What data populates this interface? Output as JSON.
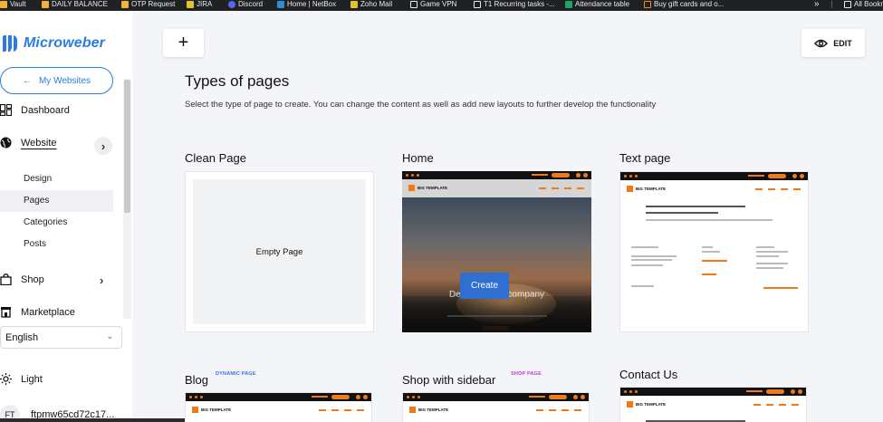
{
  "bookmarks": [
    {
      "label": "Vault",
      "color": "#f2b233"
    },
    {
      "label": "DAILY BALANCE",
      "color": "#f2b233"
    },
    {
      "label": "OTP Request",
      "color": "#f2b233"
    },
    {
      "label": "JIRA",
      "color": "#e0c229"
    },
    {
      "label": "Discord",
      "color": "#5865f2"
    },
    {
      "label": "Home | NetBox",
      "color": "#2f8bd6"
    },
    {
      "label": "Zoho Mail",
      "color": "#e8eaed"
    },
    {
      "label": "Game VPN",
      "color": "#e8eaed"
    },
    {
      "label": "T1 Recurring tasks -...",
      "color": "#e8eaed"
    },
    {
      "label": "Attendance table",
      "color": "#21a366"
    },
    {
      "label": "Buy gift cards and o...",
      "color": "#f08a24"
    },
    {
      "label": "All Bookmarks",
      "color": "#e8eaed"
    }
  ],
  "bookmarks_more": "»",
  "brand": {
    "name": "Microweber",
    "color": "#2a7be4"
  },
  "sidebar": {
    "my_websites": "My Websites",
    "my_websites_arrow": "←",
    "dashboard": "Dashboard",
    "website": "Website",
    "website_chevron": "›",
    "sub_items": [
      "Design",
      "Pages",
      "Categories",
      "Posts"
    ],
    "active_sub": "Pages",
    "shop": "Shop",
    "shop_chevron": "›",
    "marketplace": "Marketplace",
    "language": "English",
    "language_caret": "⌄",
    "theme": "Light",
    "user_initials": "FT",
    "user_name": "ftpmw65cd72c17..."
  },
  "toolbar": {
    "add_label": "+",
    "edit_label": "EDIT"
  },
  "main": {
    "title": "Types of pages",
    "subtitle": "Select the type of page to create. You can change the content as well as add new layouts to further develop the functionality"
  },
  "cards": {
    "clean": {
      "title": "Clean Page",
      "empty_label": "Empty Page"
    },
    "home": {
      "title": "Home",
      "create_label": "Create",
      "hero_text": "Describe your company"
    },
    "text": {
      "title": "Text page"
    },
    "blog": {
      "title": "Blog",
      "badge": "DYNAMIC PAGE",
      "badge_color": "#3a6ee8"
    },
    "shop_sidebar": {
      "title": "Shop with sidebar",
      "badge": "SHOP PAGE",
      "badge_color": "#c23ad6"
    },
    "contact": {
      "title": "Contact Us"
    }
  },
  "template": {
    "logo_text": "BIG TEMPLATE",
    "accent_color": "#f07a1a"
  }
}
